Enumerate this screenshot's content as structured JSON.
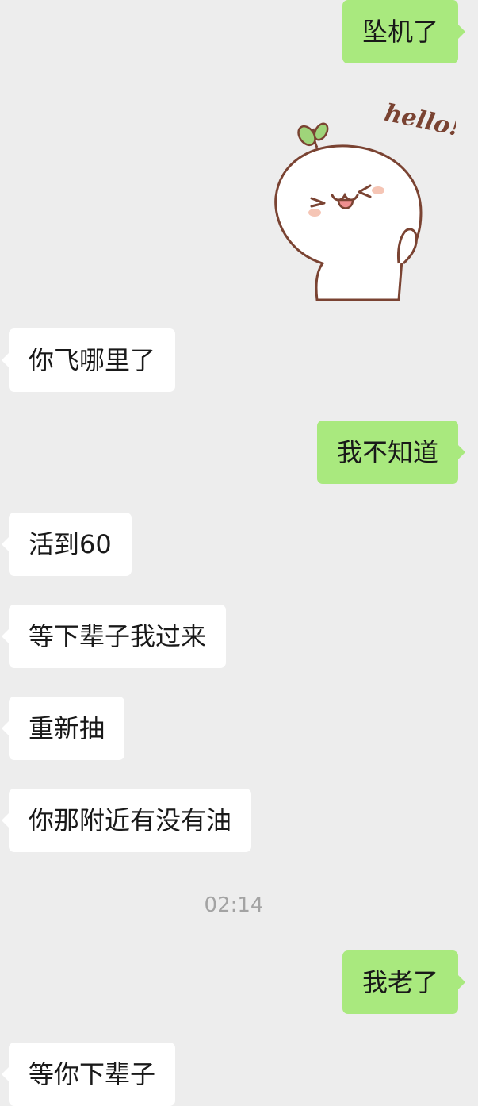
{
  "messages": [
    {
      "side": "out",
      "text": "坠机了"
    },
    {
      "side": "out",
      "type": "sticker",
      "sticker_text": "hello!"
    },
    {
      "side": "in",
      "text": "你飞哪里了"
    },
    {
      "side": "out",
      "text": "我不知道"
    },
    {
      "side": "in",
      "text": "活到60"
    },
    {
      "side": "in",
      "text": "等下辈子我过来"
    },
    {
      "side": "in",
      "text": "重新抽"
    },
    {
      "side": "in",
      "text": "你那附近有没有油"
    },
    {
      "side": "out",
      "text": "我老了"
    },
    {
      "side": "in",
      "text": "等你下辈子"
    }
  ],
  "timestamp": "02:14",
  "colors": {
    "background": "#ededed",
    "incoming_bubble": "#ffffff",
    "outgoing_bubble": "#a9e97e",
    "text": "#191919",
    "timestamp": "#a3a3a3"
  }
}
